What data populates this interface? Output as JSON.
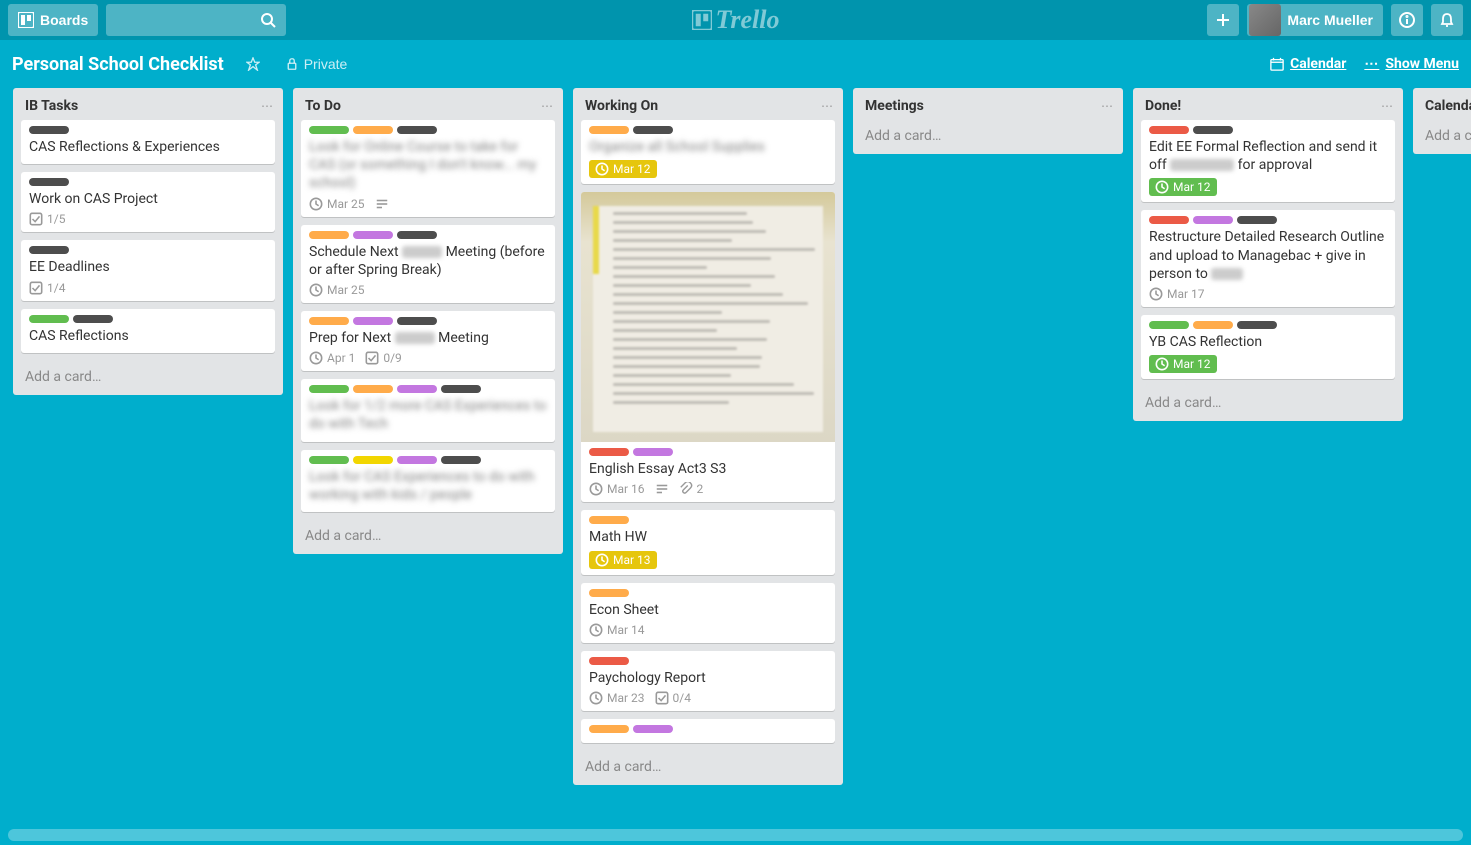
{
  "header": {
    "boards_label": "Boards",
    "app_name": "Trello",
    "user_name": "Marc Mueller",
    "calendar_label": "Calendar",
    "show_menu_label": "Show Menu"
  },
  "board": {
    "title": "Personal School Checklist",
    "privacy": "Private"
  },
  "lists": [
    {
      "title": "IB Tasks",
      "add_label": "Add a card…",
      "cards": [
        {
          "labels": [
            "darkgray"
          ],
          "title": "CAS Reflections & Experiences"
        },
        {
          "labels": [
            "darkgray"
          ],
          "title": "Work on CAS Project",
          "checklist": "1/5"
        },
        {
          "labels": [
            "darkgray"
          ],
          "title": "EE Deadlines",
          "checklist": "1/4"
        },
        {
          "labels": [
            "green",
            "darkgray"
          ],
          "title": "CAS Reflections"
        }
      ]
    },
    {
      "title": "To Do",
      "add_label": "Add a card…",
      "cards": [
        {
          "labels": [
            "green",
            "orange",
            "darkgray"
          ],
          "title_blur": "Look for Online Course to take for CAS (or something I don't know... my school)",
          "due": "Mar 25",
          "desc": true
        },
        {
          "labels": [
            "orange",
            "purple",
            "darkgray"
          ],
          "title": "Schedule Next ",
          "title_blur_mid": "xxxxx",
          "title_after": " Meeting (before or after Spring Break)",
          "due": "Mar 25"
        },
        {
          "labels": [
            "orange",
            "purple",
            "darkgray"
          ],
          "title": "Prep for Next ",
          "title_blur_mid": "xxxxx",
          "title_after": " Meeting",
          "due": "Apr 1",
          "checklist": "0/9"
        },
        {
          "labels": [
            "green",
            "orange",
            "purple",
            "darkgray"
          ],
          "title_blur": "Look for 1/2 more CAS Experiences to do with Tech"
        },
        {
          "labels": [
            "green",
            "yellow",
            "purple",
            "darkgray"
          ],
          "title_blur": "Look for CAS Experiences to do with working with kids / people"
        }
      ]
    },
    {
      "title": "Working On",
      "add_label": "Add a card…",
      "cards": [
        {
          "labels": [
            "orange",
            "darkgray"
          ],
          "title_blur": "Organize all School Supplies",
          "due": "Mar 12",
          "due_color": "yellow"
        },
        {
          "labels": [
            "red",
            "purple"
          ],
          "title": "English Essay Act3 S3",
          "due": "Mar 16",
          "desc": true,
          "attach": "2",
          "cover": true
        },
        {
          "labels": [
            "orange"
          ],
          "title": "Math HW",
          "due": "Mar 13",
          "due_color": "yellow"
        },
        {
          "labels": [
            "orange"
          ],
          "title": "Econ Sheet",
          "due": "Mar 14"
        },
        {
          "labels": [
            "red"
          ],
          "title": "Paychology Report",
          "due": "Mar 23",
          "checklist": "0/4"
        },
        {
          "labels": [
            "orange",
            "purple"
          ]
        }
      ]
    },
    {
      "title": "Meetings",
      "add_label": "Add a card…",
      "cards": []
    },
    {
      "title": "Done!",
      "add_label": "Add a card…",
      "cards": [
        {
          "labels": [
            "red",
            "darkgray"
          ],
          "title": "Edit EE Formal Reflection and send it off ",
          "title_blur_mid": "to xxxxx",
          "title_after": " for approval",
          "due": "Mar 12",
          "due_color": "green"
        },
        {
          "labels": [
            "red",
            "purple",
            "darkgray"
          ],
          "title": "Restructure Detailed Research Outline and upload to Managebac + give in person to ",
          "title_blur_mid": "xx x",
          "due": "Mar 17"
        },
        {
          "labels": [
            "green",
            "orange",
            "darkgray"
          ],
          "title": "YB CAS Reflection",
          "due": "Mar 12",
          "due_color": "green"
        }
      ]
    },
    {
      "title": "Calenda",
      "add_label": "Add a ca",
      "cards": [],
      "partial": true
    }
  ]
}
